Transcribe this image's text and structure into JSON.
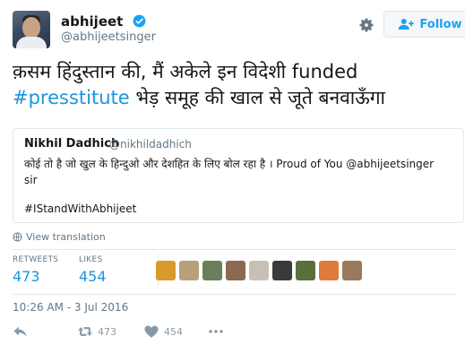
{
  "author": {
    "name": "abhijeet",
    "handle": "@abhijeetsinger",
    "verified": true,
    "avatar_icon": "user-avatar"
  },
  "header": {
    "settings_icon": "gear-icon",
    "follow_label": "Follow"
  },
  "tweet": {
    "text_before": "क़सम हिंदुस्तान की, मैं अकेले इन विदेशी funded",
    "hashtag": "#presstitute",
    "text_after": " भेड़ समूह की खाल से जूते बनवाऊँगा"
  },
  "quoted_tweet": {
    "name": "Nikhil Dadhich",
    "handle": "@nikhildadhich",
    "text": "कोई तो है जो खुल के हिन्दुओ और देशहित के लिए बोल रहा है । Proud of You @abhijeetsinger sir",
    "hashtag": "#IStandWithAbhijeet"
  },
  "view_translation": "View translation",
  "stats": {
    "retweets_label": "RETWEETS",
    "retweets_value": "473",
    "likes_label": "LIKES",
    "likes_value": "454"
  },
  "likers": [
    {
      "color": "#d89a2a"
    },
    {
      "color": "#b8a07a"
    },
    {
      "color": "#6a7f5a"
    },
    {
      "color": "#8a6a52"
    },
    {
      "color": "#c8c0b4"
    },
    {
      "color": "#3a3a3a"
    },
    {
      "color": "#5b6f3e"
    },
    {
      "color": "#e07a3a"
    },
    {
      "color": "#9a7a5a"
    }
  ],
  "timestamp": "10:26 AM - 3 Jul 2016",
  "actions": {
    "reply_icon": "reply-icon",
    "retweet_icon": "retweet-icon",
    "retweet_count": "473",
    "like_icon": "heart-icon",
    "like_count": "454",
    "more_icon": "more-icon"
  },
  "colors": {
    "link_blue": "#1b95e0",
    "verified_blue": "#1da1f2",
    "muted_gray": "#657786",
    "border": "#e1e8ed"
  }
}
